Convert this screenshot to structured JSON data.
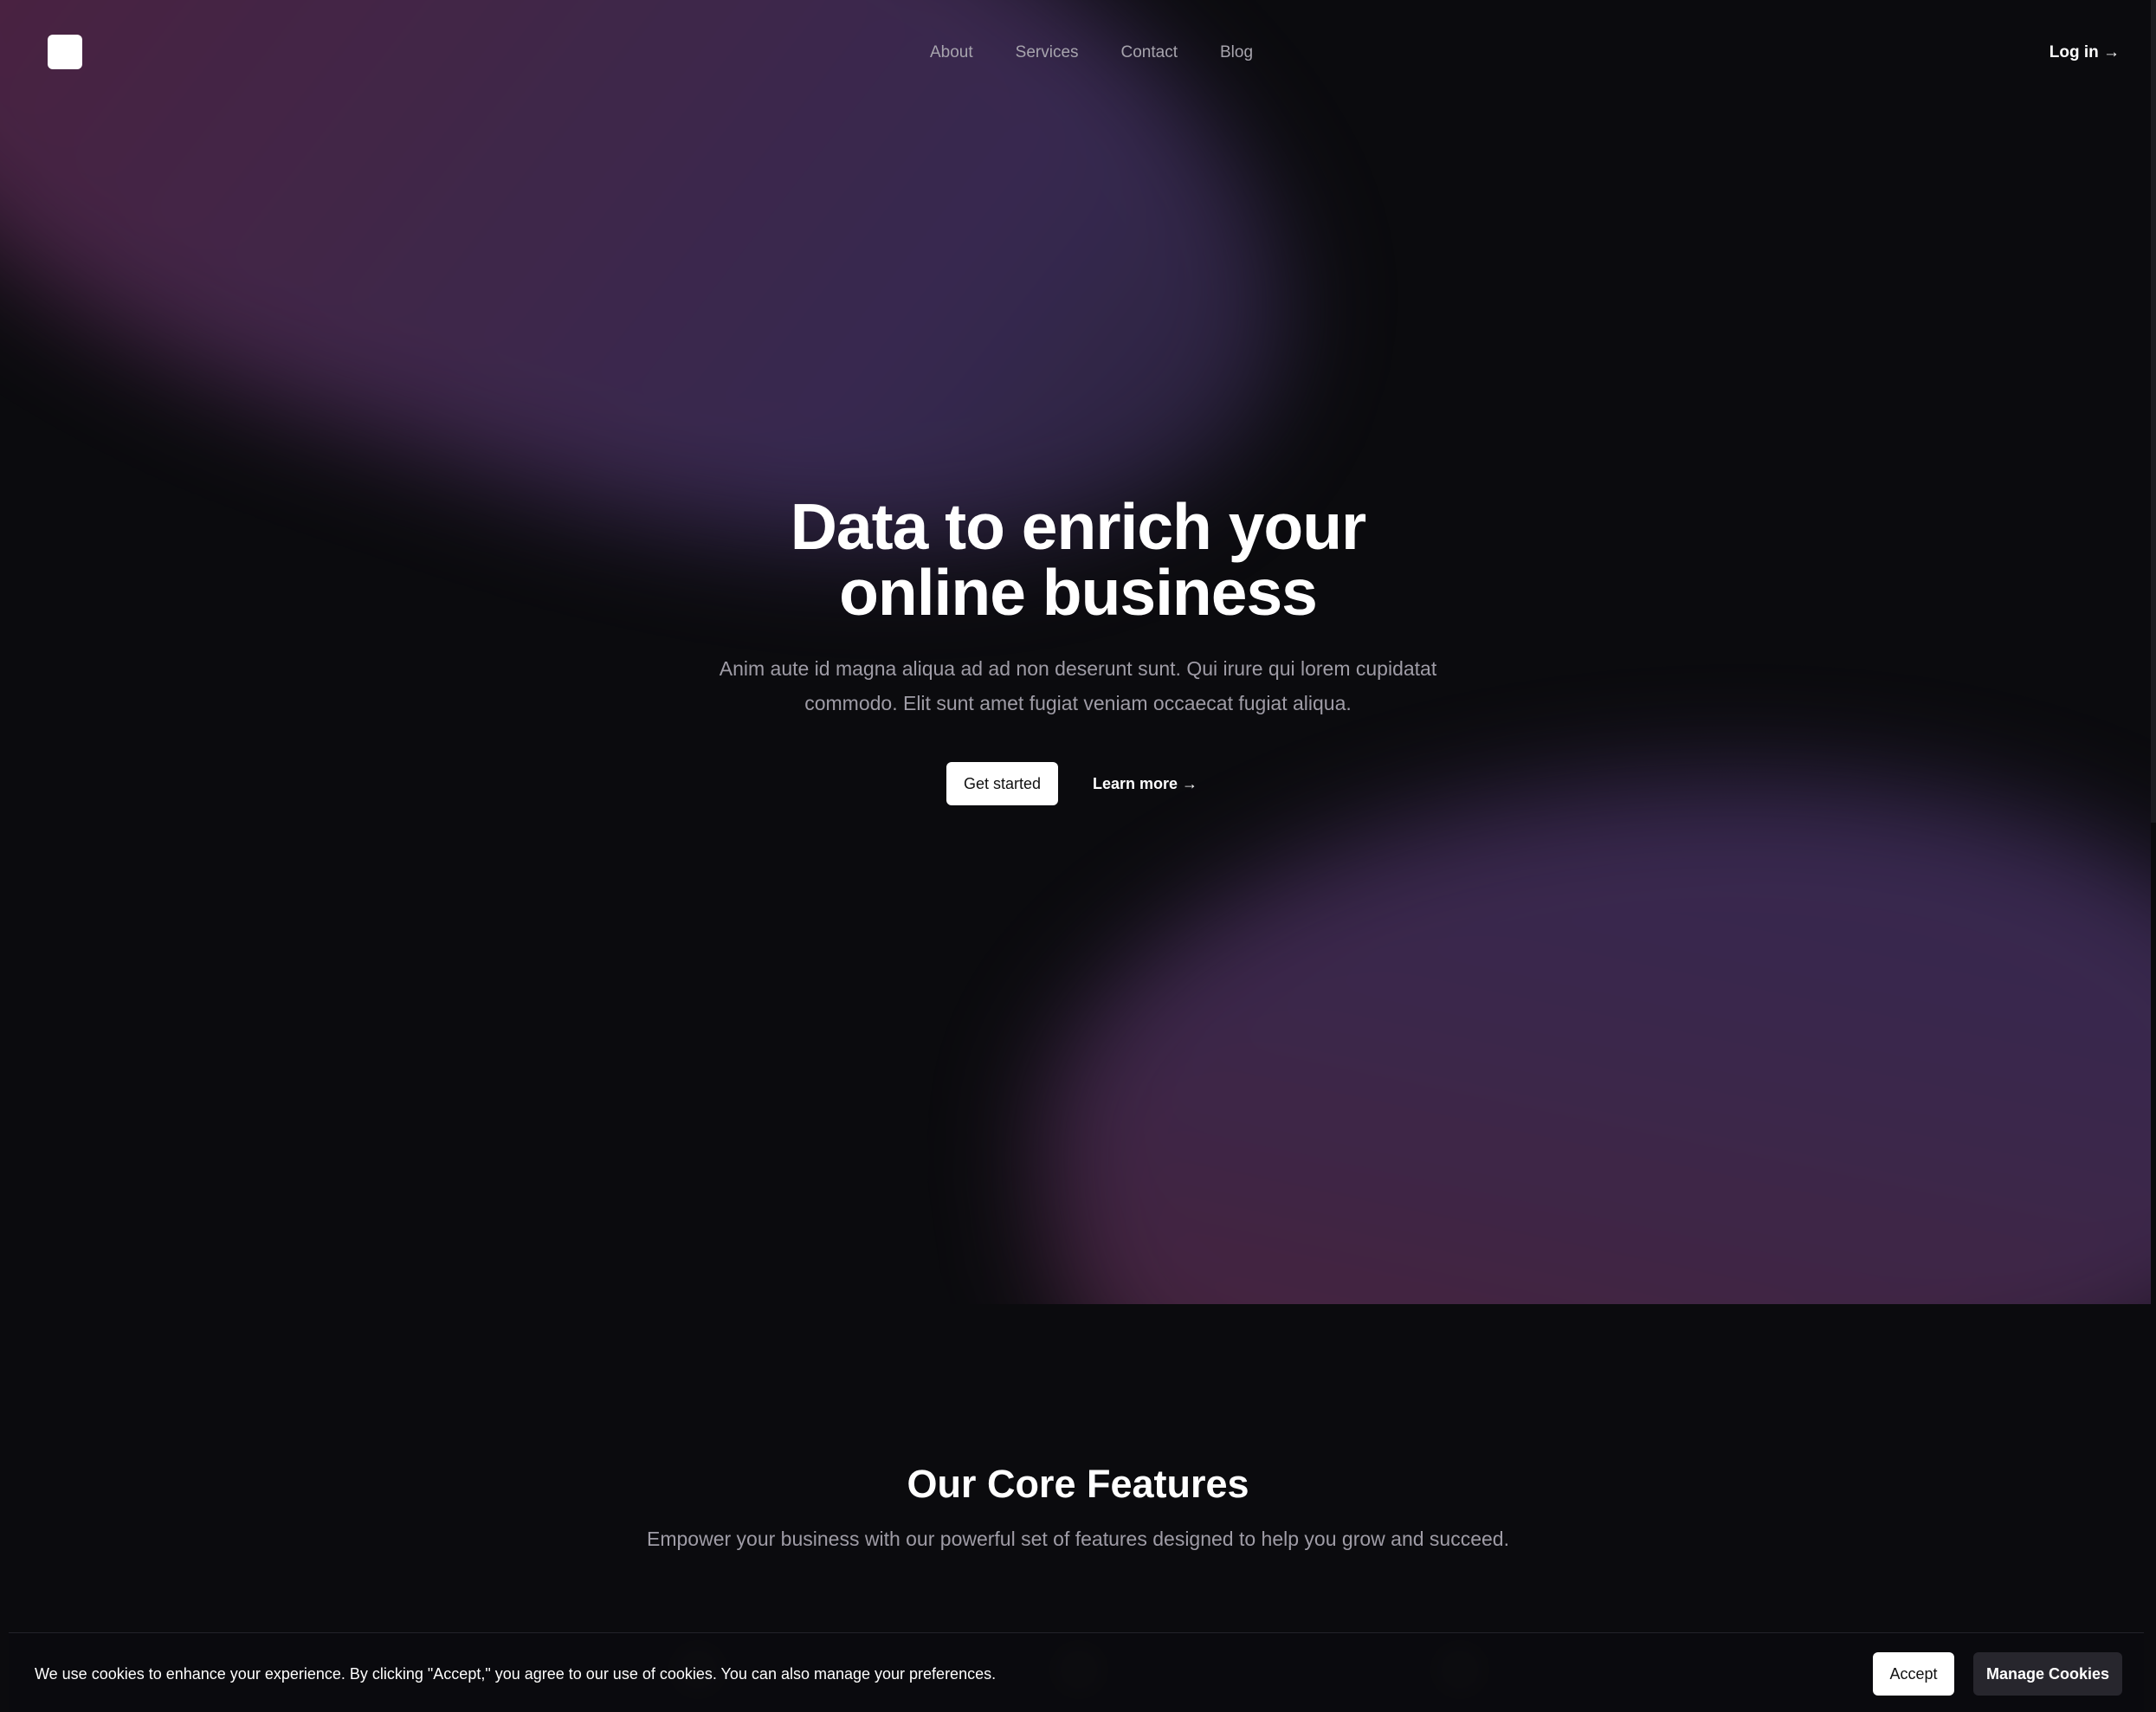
{
  "nav": {
    "items": [
      {
        "label": "About"
      },
      {
        "label": "Services"
      },
      {
        "label": "Contact"
      },
      {
        "label": "Blog"
      }
    ],
    "login_label": "Log in →"
  },
  "hero": {
    "title_line1": "Data to enrich your",
    "title_line2": "online business",
    "subtitle": "Anim aute id magna aliqua ad ad non deserunt sunt. Qui irure qui lorem cupidatat commodo. Elit sunt amet fugiat veniam occaecat fugiat aliqua.",
    "primary_button": "Get started",
    "secondary_link": "Learn more  →"
  },
  "features": {
    "title": "Our Core Features",
    "subtitle": "Empower your business with our powerful set of features designed to help you grow and succeed."
  },
  "cookie_banner": {
    "text": "We use cookies to enhance your experience. By clicking \"Accept,\" you agree to our use of cookies. You can also manage your preferences.",
    "accept_label": "Accept",
    "manage_label": "Manage Cookies"
  },
  "colors": {
    "background": "#0b0b0e",
    "gradient_pink": "#5a2446",
    "gradient_purple": "#3f2f5c",
    "primary_button_bg": "#ffffff",
    "secondary_button_bg": "#27262d"
  }
}
